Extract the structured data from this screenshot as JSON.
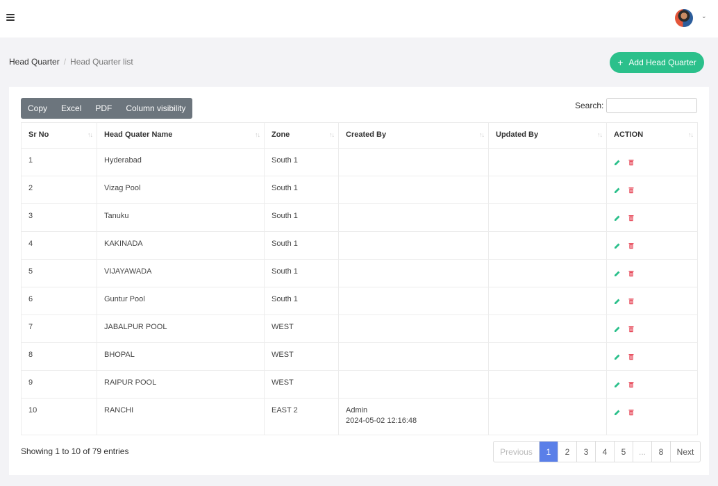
{
  "breadcrumb": {
    "home": "Head Quarter",
    "separator": "/",
    "current": "Head Quarter list"
  },
  "add_button": {
    "icon": "+",
    "label": "Add Head Quarter"
  },
  "toolbar": {
    "copy": "Copy",
    "excel": "Excel",
    "pdf": "PDF",
    "colvis": "Column visibility"
  },
  "search": {
    "label": "Search:",
    "placeholder": "",
    "value": ""
  },
  "table": {
    "headers": [
      "Sr No",
      "Head Quater Name",
      "Zone",
      "Created By",
      "Updated By",
      "ACTION"
    ],
    "rows": [
      {
        "sr": "1",
        "name": "Hyderabad",
        "zone": "South 1",
        "created_by": "",
        "created_at": "",
        "updated_by": ""
      },
      {
        "sr": "2",
        "name": "Vizag Pool",
        "zone": "South 1",
        "created_by": "",
        "created_at": "",
        "updated_by": ""
      },
      {
        "sr": "3",
        "name": "Tanuku",
        "zone": "South 1",
        "created_by": "",
        "created_at": "",
        "updated_by": ""
      },
      {
        "sr": "4",
        "name": "KAKINADA",
        "zone": "South 1",
        "created_by": "",
        "created_at": "",
        "updated_by": ""
      },
      {
        "sr": "5",
        "name": "VIJAYAWADA",
        "zone": "South 1",
        "created_by": "",
        "created_at": "",
        "updated_by": ""
      },
      {
        "sr": "6",
        "name": "Guntur Pool",
        "zone": "South 1",
        "created_by": "",
        "created_at": "",
        "updated_by": ""
      },
      {
        "sr": "7",
        "name": "JABALPUR POOL",
        "zone": "WEST",
        "created_by": "",
        "created_at": "",
        "updated_by": ""
      },
      {
        "sr": "8",
        "name": "BHOPAL",
        "zone": "WEST",
        "created_by": "",
        "created_at": "",
        "updated_by": ""
      },
      {
        "sr": "9",
        "name": "RAIPUR POOL",
        "zone": "WEST",
        "created_by": "",
        "created_at": "",
        "updated_by": ""
      },
      {
        "sr": "10",
        "name": "RANCHI",
        "zone": "EAST 2",
        "created_by": "Admin",
        "created_at": "2024-05-02 12:16:48",
        "updated_by": ""
      }
    ]
  },
  "footer": {
    "info": "Showing 1 to 10 of 79 entries"
  },
  "pagination": {
    "previous": "Previous",
    "pages": [
      "1",
      "2",
      "3",
      "4",
      "5"
    ],
    "ellipsis": "...",
    "last": "8",
    "next": "Next"
  },
  "colors": {
    "accent_green": "#2bc08b",
    "active_page": "#5a7fe8",
    "edit": "#2bc08b",
    "delete": "#e74c5c",
    "button_group": "#6c757d"
  }
}
